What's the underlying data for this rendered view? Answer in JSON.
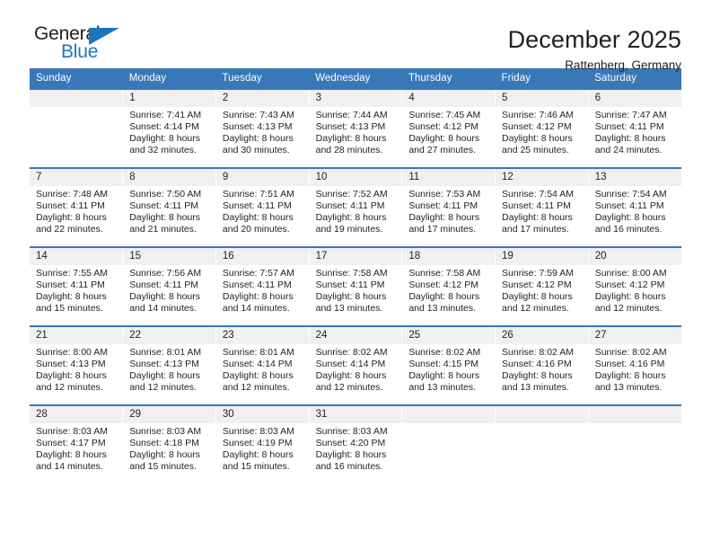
{
  "brand": {
    "name_part1": "General",
    "name_part2": "Blue",
    "accent_color": "#1b76bc",
    "triangle_icon": "triangle-icon"
  },
  "header": {
    "title": "December 2025",
    "subtitle": "Rattenberg, Germany"
  },
  "calendar": {
    "header_bg": "#3878b8",
    "daynum_bg": "#f0f0f0",
    "weekdays": [
      "Sunday",
      "Monday",
      "Tuesday",
      "Wednesday",
      "Thursday",
      "Friday",
      "Saturday"
    ],
    "labels": {
      "sunrise": "Sunrise:",
      "sunset": "Sunset:",
      "daylight": "Daylight:"
    },
    "weeks": [
      [
        {
          "day": "",
          "sunrise": "",
          "sunset": "",
          "daylight_line1": "",
          "daylight_line2": ""
        },
        {
          "day": "1",
          "sunrise": "Sunrise: 7:41 AM",
          "sunset": "Sunset: 4:14 PM",
          "daylight_line1": "Daylight: 8 hours",
          "daylight_line2": "and 32 minutes."
        },
        {
          "day": "2",
          "sunrise": "Sunrise: 7:43 AM",
          "sunset": "Sunset: 4:13 PM",
          "daylight_line1": "Daylight: 8 hours",
          "daylight_line2": "and 30 minutes."
        },
        {
          "day": "3",
          "sunrise": "Sunrise: 7:44 AM",
          "sunset": "Sunset: 4:13 PM",
          "daylight_line1": "Daylight: 8 hours",
          "daylight_line2": "and 28 minutes."
        },
        {
          "day": "4",
          "sunrise": "Sunrise: 7:45 AM",
          "sunset": "Sunset: 4:12 PM",
          "daylight_line1": "Daylight: 8 hours",
          "daylight_line2": "and 27 minutes."
        },
        {
          "day": "5",
          "sunrise": "Sunrise: 7:46 AM",
          "sunset": "Sunset: 4:12 PM",
          "daylight_line1": "Daylight: 8 hours",
          "daylight_line2": "and 25 minutes."
        },
        {
          "day": "6",
          "sunrise": "Sunrise: 7:47 AM",
          "sunset": "Sunset: 4:11 PM",
          "daylight_line1": "Daylight: 8 hours",
          "daylight_line2": "and 24 minutes."
        }
      ],
      [
        {
          "day": "7",
          "sunrise": "Sunrise: 7:48 AM",
          "sunset": "Sunset: 4:11 PM",
          "daylight_line1": "Daylight: 8 hours",
          "daylight_line2": "and 22 minutes."
        },
        {
          "day": "8",
          "sunrise": "Sunrise: 7:50 AM",
          "sunset": "Sunset: 4:11 PM",
          "daylight_line1": "Daylight: 8 hours",
          "daylight_line2": "and 21 minutes."
        },
        {
          "day": "9",
          "sunrise": "Sunrise: 7:51 AM",
          "sunset": "Sunset: 4:11 PM",
          "daylight_line1": "Daylight: 8 hours",
          "daylight_line2": "and 20 minutes."
        },
        {
          "day": "10",
          "sunrise": "Sunrise: 7:52 AM",
          "sunset": "Sunset: 4:11 PM",
          "daylight_line1": "Daylight: 8 hours",
          "daylight_line2": "and 19 minutes."
        },
        {
          "day": "11",
          "sunrise": "Sunrise: 7:53 AM",
          "sunset": "Sunset: 4:11 PM",
          "daylight_line1": "Daylight: 8 hours",
          "daylight_line2": "and 17 minutes."
        },
        {
          "day": "12",
          "sunrise": "Sunrise: 7:54 AM",
          "sunset": "Sunset: 4:11 PM",
          "daylight_line1": "Daylight: 8 hours",
          "daylight_line2": "and 17 minutes."
        },
        {
          "day": "13",
          "sunrise": "Sunrise: 7:54 AM",
          "sunset": "Sunset: 4:11 PM",
          "daylight_line1": "Daylight: 8 hours",
          "daylight_line2": "and 16 minutes."
        }
      ],
      [
        {
          "day": "14",
          "sunrise": "Sunrise: 7:55 AM",
          "sunset": "Sunset: 4:11 PM",
          "daylight_line1": "Daylight: 8 hours",
          "daylight_line2": "and 15 minutes."
        },
        {
          "day": "15",
          "sunrise": "Sunrise: 7:56 AM",
          "sunset": "Sunset: 4:11 PM",
          "daylight_line1": "Daylight: 8 hours",
          "daylight_line2": "and 14 minutes."
        },
        {
          "day": "16",
          "sunrise": "Sunrise: 7:57 AM",
          "sunset": "Sunset: 4:11 PM",
          "daylight_line1": "Daylight: 8 hours",
          "daylight_line2": "and 14 minutes."
        },
        {
          "day": "17",
          "sunrise": "Sunrise: 7:58 AM",
          "sunset": "Sunset: 4:11 PM",
          "daylight_line1": "Daylight: 8 hours",
          "daylight_line2": "and 13 minutes."
        },
        {
          "day": "18",
          "sunrise": "Sunrise: 7:58 AM",
          "sunset": "Sunset: 4:12 PM",
          "daylight_line1": "Daylight: 8 hours",
          "daylight_line2": "and 13 minutes."
        },
        {
          "day": "19",
          "sunrise": "Sunrise: 7:59 AM",
          "sunset": "Sunset: 4:12 PM",
          "daylight_line1": "Daylight: 8 hours",
          "daylight_line2": "and 12 minutes."
        },
        {
          "day": "20",
          "sunrise": "Sunrise: 8:00 AM",
          "sunset": "Sunset: 4:12 PM",
          "daylight_line1": "Daylight: 8 hours",
          "daylight_line2": "and 12 minutes."
        }
      ],
      [
        {
          "day": "21",
          "sunrise": "Sunrise: 8:00 AM",
          "sunset": "Sunset: 4:13 PM",
          "daylight_line1": "Daylight: 8 hours",
          "daylight_line2": "and 12 minutes."
        },
        {
          "day": "22",
          "sunrise": "Sunrise: 8:01 AM",
          "sunset": "Sunset: 4:13 PM",
          "daylight_line1": "Daylight: 8 hours",
          "daylight_line2": "and 12 minutes."
        },
        {
          "day": "23",
          "sunrise": "Sunrise: 8:01 AM",
          "sunset": "Sunset: 4:14 PM",
          "daylight_line1": "Daylight: 8 hours",
          "daylight_line2": "and 12 minutes."
        },
        {
          "day": "24",
          "sunrise": "Sunrise: 8:02 AM",
          "sunset": "Sunset: 4:14 PM",
          "daylight_line1": "Daylight: 8 hours",
          "daylight_line2": "and 12 minutes."
        },
        {
          "day": "25",
          "sunrise": "Sunrise: 8:02 AM",
          "sunset": "Sunset: 4:15 PM",
          "daylight_line1": "Daylight: 8 hours",
          "daylight_line2": "and 13 minutes."
        },
        {
          "day": "26",
          "sunrise": "Sunrise: 8:02 AM",
          "sunset": "Sunset: 4:16 PM",
          "daylight_line1": "Daylight: 8 hours",
          "daylight_line2": "and 13 minutes."
        },
        {
          "day": "27",
          "sunrise": "Sunrise: 8:02 AM",
          "sunset": "Sunset: 4:16 PM",
          "daylight_line1": "Daylight: 8 hours",
          "daylight_line2": "and 13 minutes."
        }
      ],
      [
        {
          "day": "28",
          "sunrise": "Sunrise: 8:03 AM",
          "sunset": "Sunset: 4:17 PM",
          "daylight_line1": "Daylight: 8 hours",
          "daylight_line2": "and 14 minutes."
        },
        {
          "day": "29",
          "sunrise": "Sunrise: 8:03 AM",
          "sunset": "Sunset: 4:18 PM",
          "daylight_line1": "Daylight: 8 hours",
          "daylight_line2": "and 15 minutes."
        },
        {
          "day": "30",
          "sunrise": "Sunrise: 8:03 AM",
          "sunset": "Sunset: 4:19 PM",
          "daylight_line1": "Daylight: 8 hours",
          "daylight_line2": "and 15 minutes."
        },
        {
          "day": "31",
          "sunrise": "Sunrise: 8:03 AM",
          "sunset": "Sunset: 4:20 PM",
          "daylight_line1": "Daylight: 8 hours",
          "daylight_line2": "and 16 minutes."
        },
        {
          "day": "",
          "sunrise": "",
          "sunset": "",
          "daylight_line1": "",
          "daylight_line2": ""
        },
        {
          "day": "",
          "sunrise": "",
          "sunset": "",
          "daylight_line1": "",
          "daylight_line2": ""
        },
        {
          "day": "",
          "sunrise": "",
          "sunset": "",
          "daylight_line1": "",
          "daylight_line2": ""
        }
      ]
    ]
  }
}
